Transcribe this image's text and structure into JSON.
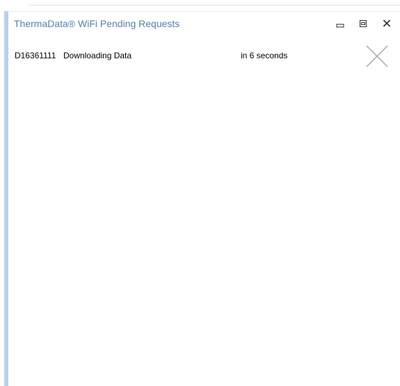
{
  "window": {
    "title": "ThermaData® WiFi Pending Requests"
  },
  "titlebar_icons": {
    "minimize": "minimize-icon",
    "maximize": "maximize-icon",
    "close": "close-icon"
  },
  "requests": [
    {
      "device_id": "D16361111",
      "status": "Downloading Data",
      "time": "in 6 seconds",
      "cancel_icon": "cancel-x-icon"
    }
  ],
  "colors": {
    "title_text": "#5b7ea6",
    "window_border": "#bcd0e7",
    "cancel_x": "#a8a8a8"
  }
}
